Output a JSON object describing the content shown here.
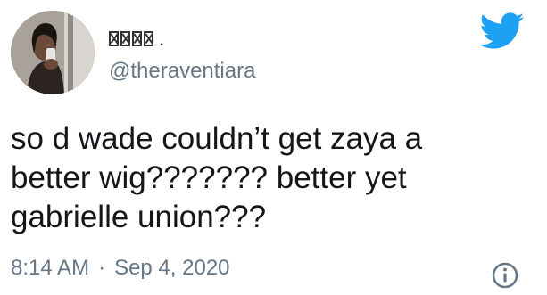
{
  "tweet": {
    "display_name_suffix": ".",
    "handle": "@theraventiara",
    "text": "so d wade couldn’t get zaya a\nbetter wig??????? better yet\ngabrielle union???",
    "time": "8:14 AM",
    "separator": "·",
    "date": "Sep 4, 2020"
  },
  "icons": {
    "brand": "twitter-bird-icon",
    "info": "info-circle-icon",
    "name_glyphs": "missing-glyph-boxes"
  },
  "colors": {
    "twitter_blue": "#1da1f2",
    "text": "#14171a",
    "secondary": "#657786"
  }
}
